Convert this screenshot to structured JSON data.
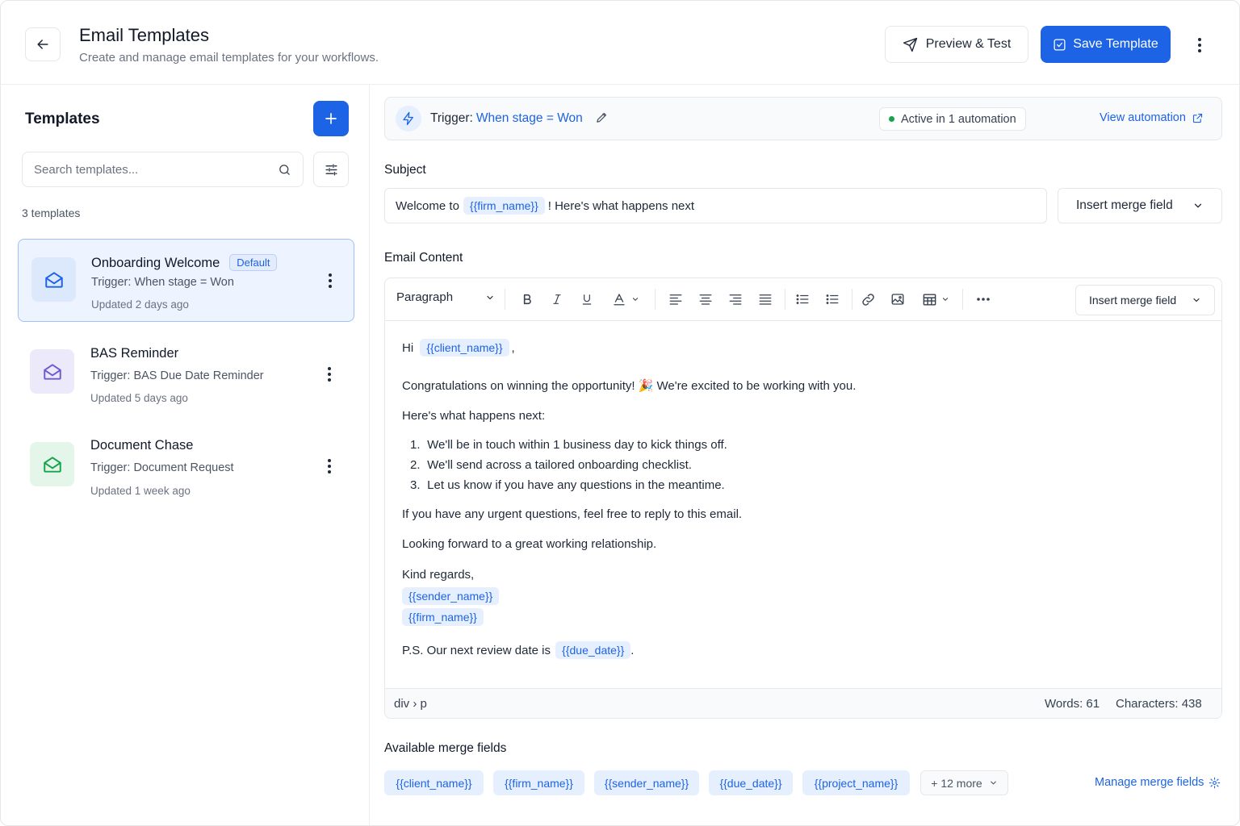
{
  "header": {
    "title": "Email Templates",
    "subtitle": "Create and manage email templates for your workflows.",
    "preview_label": "Preview & Test",
    "save_label": "Save Template"
  },
  "sidebar": {
    "title": "Templates",
    "search_placeholder": "Search templates...",
    "count_label": "3 templates",
    "templates": [
      {
        "name": "Onboarding Welcome",
        "badge": "Default",
        "trigger": "Trigger: When stage = Won",
        "updated": "Updated 2 days ago",
        "icon": "mail-open-icon",
        "icon_color": "#1d63e6",
        "icon_bg": "#dce8fc",
        "selected": true
      },
      {
        "name": "BAS Reminder",
        "trigger": "Trigger: BAS Due Date Reminder",
        "updated": "Updated 5 days ago",
        "icon": "mail-open-icon",
        "icon_color": "#6d5bd0",
        "icon_bg": "#ece9fb",
        "selected": false
      },
      {
        "name": "Document Chase",
        "trigger": "Trigger: Document Request",
        "updated": "Updated 1 week ago",
        "icon": "mail-open-icon",
        "icon_color": "#16a34a",
        "icon_bg": "#e4f6ea",
        "selected": false
      }
    ]
  },
  "trigger_bar": {
    "label": "Trigger:",
    "value": "When stage = Won",
    "status": "Active in 1 automation",
    "view_link": "View automation"
  },
  "subject": {
    "label": "Subject",
    "prefix": "Welcome to",
    "merge": "{{firm_name}}",
    "suffix": "! Here's what happens next",
    "merge_dropdown": "Insert merge field"
  },
  "editor": {
    "label": "Email Content",
    "block_format": "Paragraph",
    "merge_dropdown": "Insert merge field",
    "greeting": "Hi",
    "greeting_merge": "{{client_name}}",
    "greeting_end": ",",
    "line1": "Congratulations on winning the opportunity! 🎉 We're excited to be working with you.",
    "line2": "Here's what happens next:",
    "steps": [
      {
        "n": "1.",
        "text": "We'll be in touch within 1 business day to kick things off."
      },
      {
        "n": "2.",
        "text": "We'll send across a tailored onboarding checklist."
      },
      {
        "n": "3.",
        "text": "Let us know if you have any questions in the meantime."
      }
    ],
    "line3": "If you have any urgent questions, feel free to reply to this email.",
    "line4": "Looking forward to a great working relationship.",
    "signoff": "Kind regards,",
    "sig_merge1": "{{sender_name}}",
    "sig_merge2": "{{firm_name}}",
    "ps_prefix": "P.S. Our next review date is",
    "ps_merge": "{{due_date}}",
    "ps_end": ".",
    "path": "div › p",
    "words": "Words: 61",
    "characters": "Characters: 438"
  },
  "merge_fields": {
    "label": "Available merge fields",
    "fields": [
      "{{client_name}}",
      "{{firm_name}}",
      "{{sender_name}}",
      "{{due_date}}",
      "{{project_name}}"
    ],
    "more_label": "+ 12 more",
    "manage_label": "Manage merge fields"
  },
  "colors": {
    "accent": "#1d63e6",
    "success": "#16a34a"
  }
}
